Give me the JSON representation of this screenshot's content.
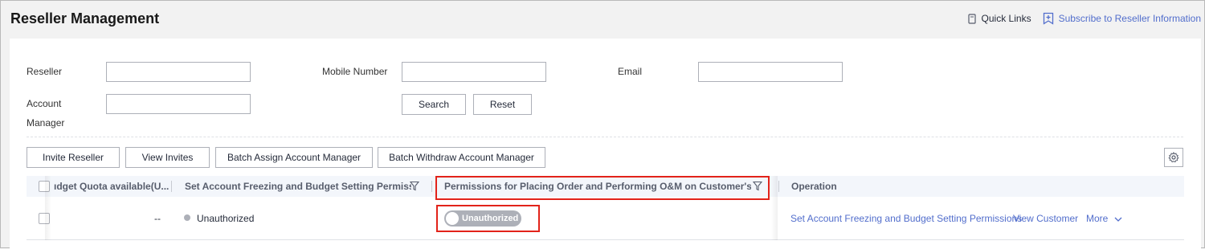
{
  "page": {
    "title": "Reseller Management",
    "quick_links": "Quick Links",
    "subscribe": "Subscribe to Reseller Information"
  },
  "filters": {
    "reseller_label": "Reseller",
    "mobile_label": "Mobile Number",
    "email_label": "Email",
    "account_manager_label_1": "Account",
    "account_manager_label_2": "Manager",
    "reseller_value": "",
    "mobile_value": "",
    "email_value": "",
    "account_manager_value": "",
    "search_button": "Search",
    "reset_button": "Reset"
  },
  "toolbar": {
    "invite_reseller": "Invite Reseller",
    "view_invites": "View Invites",
    "batch_assign": "Batch Assign Account Manager",
    "batch_withdraw": "Batch Withdraw Account Manager"
  },
  "table": {
    "columns": {
      "budget_quota": "ıdget Quota available(U...",
      "freeze_permissions": "Set Account Freezing and Budget Setting Permissio...",
      "order_permissions": "Permissions for Placing Order and Performing O&M on Customer's Behalf",
      "operation": "Operation"
    },
    "rows": [
      {
        "budget_quota": "--",
        "freeze_status": "Unauthorized",
        "order_toggle": "Unauthorized",
        "op_set_permissions": "Set Account Freezing and Budget Setting Permissions",
        "op_view_customer": "View Customer",
        "op_more": "More"
      }
    ]
  },
  "colors": {
    "link": "#526ecc",
    "highlight": "#e2231a",
    "toggle_off": "#adb0b8"
  }
}
